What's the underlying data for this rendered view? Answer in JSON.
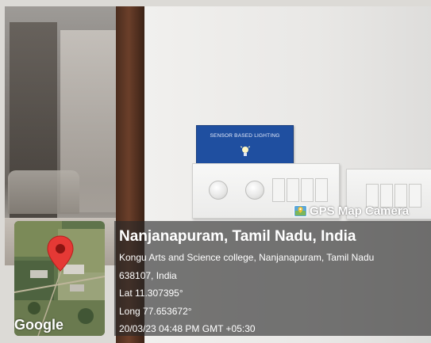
{
  "overlay": {
    "brand": "GPS Map Camera",
    "brand_icon": "gps-map-camera-icon",
    "map_logo": "Google",
    "title": "Nanjanapuram, Tamil Nadu, India",
    "address_line1": "Kongu Arts and Science college, Nanjanapuram, Tamil Nadu",
    "address_line2": "638107, India",
    "lat": "Lat 11.307395°",
    "long": "Long 77.653672°",
    "datetime": "20/03/23 04:48 PM GMT +05:30"
  },
  "scene": {
    "sign_text": "SENSOR BASED LIGHTING",
    "colors": {
      "sign_blue": "#1f4fa0",
      "overlay_bg": "#282828",
      "pin_red": "#e53935"
    }
  }
}
